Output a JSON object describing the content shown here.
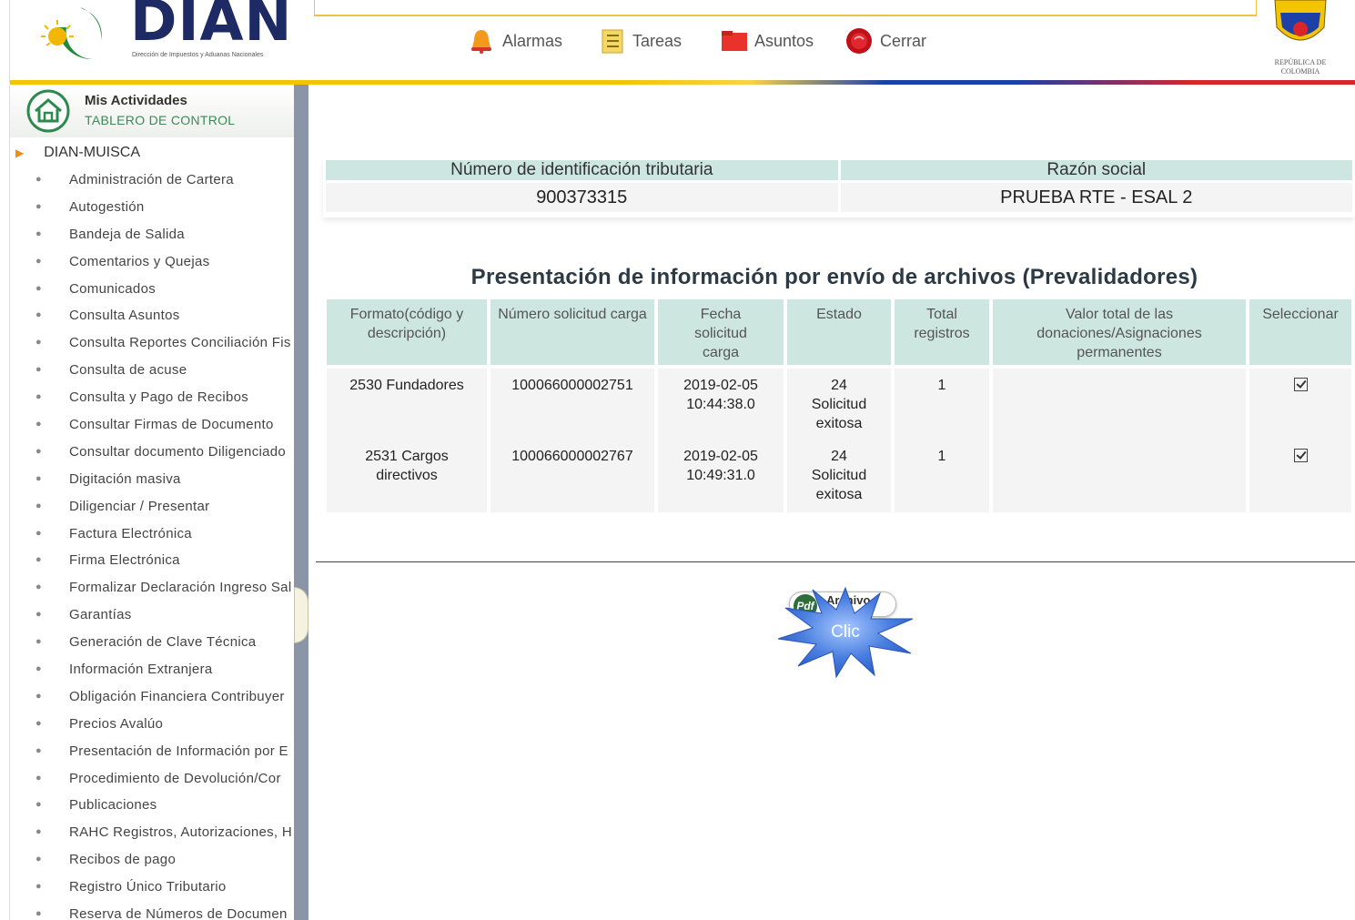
{
  "header": {
    "logo_text": "DIAN",
    "logo_subtitle": "Dirección de Impuestos y Aduanas Nacionales",
    "nav": [
      {
        "label": "Alarmas",
        "icon": "alarm-bell-icon"
      },
      {
        "label": "Tareas",
        "icon": "tasks-list-icon"
      },
      {
        "label": "Asuntos",
        "icon": "folder-icon"
      },
      {
        "label": "Cerrar",
        "icon": "close-circle-icon"
      }
    ],
    "escudo_label": "REPÚBLICA DE COLOMBIA"
  },
  "sidebar": {
    "title": "Mis Actividades",
    "subtitle": "TABLERO DE CONTROL",
    "root": "DIAN-MUISCA",
    "items": [
      "Administración de Cartera",
      "Autogestión",
      "Bandeja de Salida",
      "Comentarios y Quejas",
      "Comunicados",
      "Consulta Asuntos",
      "Consulta Reportes Conciliación Fis",
      "Consulta de acuse",
      "Consulta y Pago de Recibos",
      "Consultar Firmas de Documento",
      "Consultar documento Diligenciado",
      "Digitación masiva",
      "Diligenciar / Presentar",
      "Factura Electrónica",
      "Firma Electrónica",
      "Formalizar Declaración Ingreso Sal",
      "Garantías",
      "Generación de Clave Técnica",
      "Información Extranjera",
      "Obligación Financiera Contribuyer",
      "Precios Avalúo",
      "Presentación de Información por E",
      "Procedimiento de Devolución/Cor",
      "Publicaciones",
      "RAHC Registros, Autorizaciones, H",
      "Recibos de pago",
      "Registro Único Tributario",
      "Reserva de Números de Documen"
    ]
  },
  "taxpayer": {
    "nit_label": "Número de identificación tributaria",
    "razon_label": "Razón social",
    "nit_value": "900373315",
    "razon_value": "PRUEBA RTE - ESAL 2"
  },
  "presentacion": {
    "title": "Presentación de información por envío de archivos (Prevalidadores)",
    "columns": [
      "Formato(código y descripción)",
      "Número solicitud carga",
      "Fecha solicitud carga",
      "Estado",
      "Total registros",
      "Valor total de las donaciones/Asignaciones permanentes",
      "Seleccionar"
    ],
    "rows": [
      {
        "formato": "2530 Fundadores",
        "numero": "100066000002751",
        "fecha": "2019-02-05 10:44:38.0",
        "estado": "24 Solicitud exitosa",
        "total": "1",
        "valor": "",
        "seleccionado": true
      },
      {
        "formato": "2531 Cargos directivos",
        "numero": "100066000002767",
        "fecha": "2019-02-05 10:49:31.0",
        "estado": "24 Solicitud exitosa",
        "total": "1",
        "valor": "",
        "seleccionado": true
      }
    ]
  },
  "pdf_button": {
    "label": "Archivo Pdf",
    "icon_text": "Pdf"
  },
  "callout": {
    "label": "Clic"
  },
  "colors": {
    "accent_green": "#3a8a55",
    "table_header": "#cde6df",
    "burst": "#3f6fd8"
  }
}
